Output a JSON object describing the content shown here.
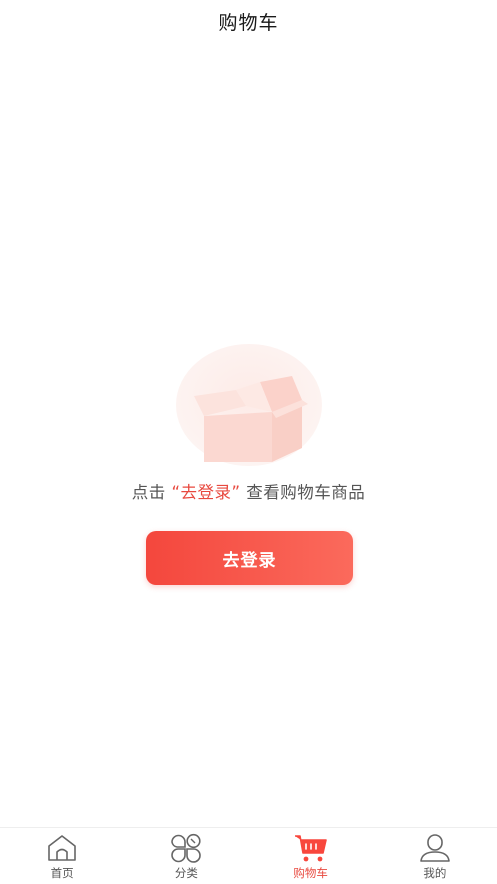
{
  "header": {
    "title": "购物车"
  },
  "empty_state": {
    "icon": "empty-box-icon",
    "prompt_prefix": "点击",
    "prompt_highlight": "“去登录”",
    "prompt_suffix": "查看购物车商品",
    "login_button": "去登录"
  },
  "colors": {
    "accent": "#e8493f",
    "button_gradient_start": "#f4473d",
    "button_gradient_end": "#fb6a5c"
  },
  "tabbar": {
    "items": [
      {
        "label": "首页",
        "icon": "home-icon",
        "active": false
      },
      {
        "label": "分类",
        "icon": "category-icon",
        "active": false
      },
      {
        "label": "购物车",
        "icon": "cart-icon",
        "active": true
      },
      {
        "label": "我的",
        "icon": "user-icon",
        "active": false
      }
    ]
  }
}
